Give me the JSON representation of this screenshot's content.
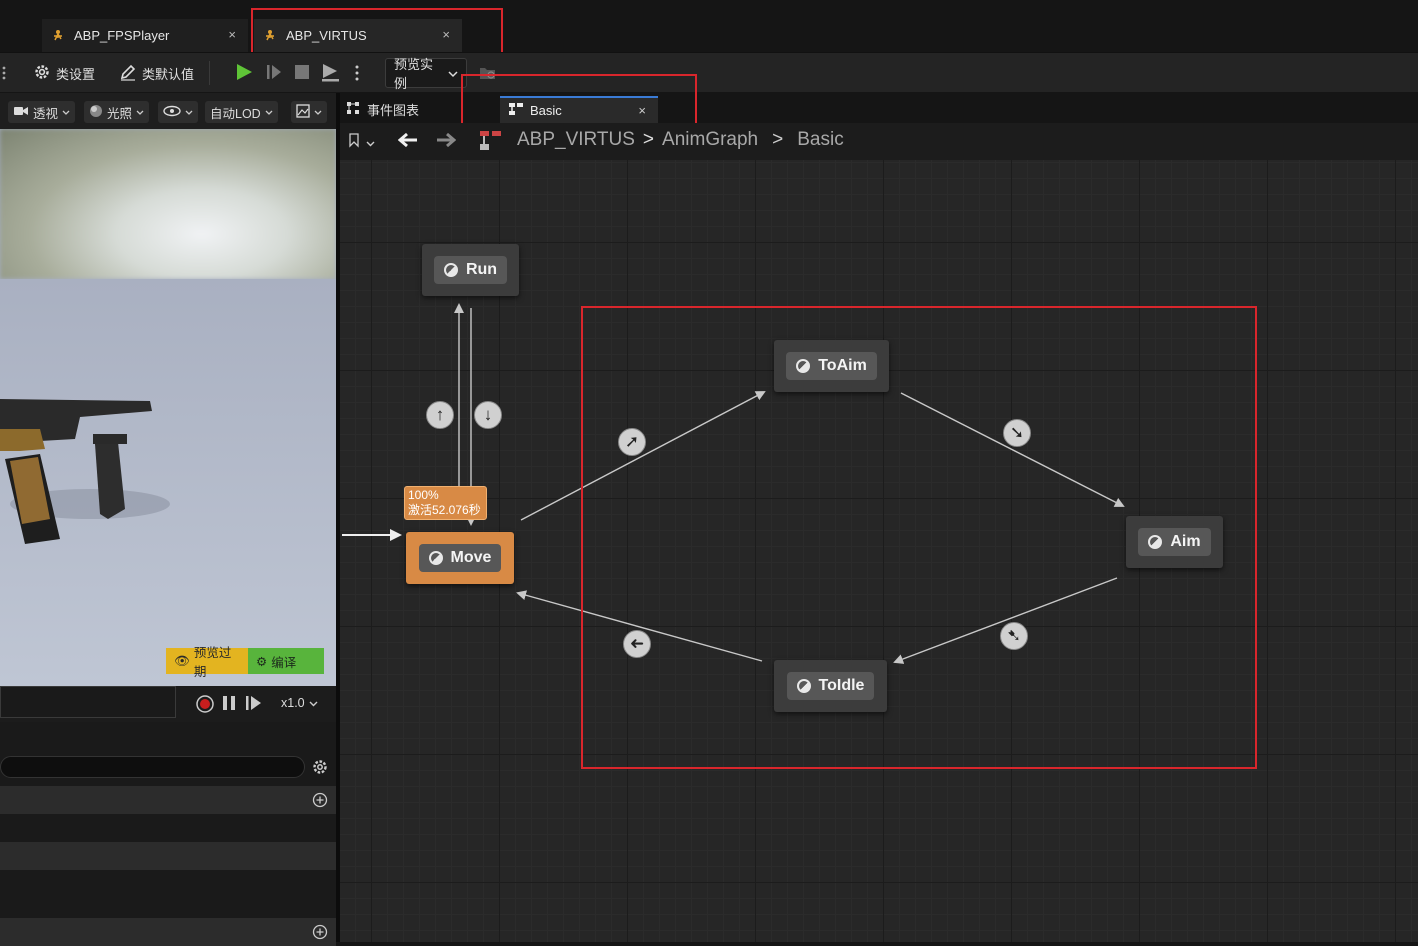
{
  "doc_tabs": [
    {
      "label": "ABP_FPSPlayer",
      "close": "×"
    },
    {
      "label": "ABP_VIRTUS",
      "close": "×"
    }
  ],
  "toolbar": {
    "class_settings": "类设置",
    "class_defaults": "类默认值",
    "preview_instance": "预览实例"
  },
  "viewport_bar": {
    "perspective": "透视",
    "lighting": "光照",
    "auto_lod": "自动LOD"
  },
  "viewport": {
    "preview_outdated": "预览过期",
    "compile": "编译"
  },
  "timeline": {
    "speed": "x1.0"
  },
  "graph_tabs": [
    {
      "label": "事件图表"
    },
    {
      "label": "Basic",
      "close": "×"
    }
  ],
  "breadcrumb": {
    "items": [
      "ABP_VIRTUS",
      "AnimGraph",
      "Basic"
    ],
    "sep": ">"
  },
  "states": {
    "run": "Run",
    "move": "Move",
    "to_aim": "ToAim",
    "aim": "Aim",
    "to_idle": "ToIdle"
  },
  "move_tooltip": {
    "weight": "100%",
    "active": "激活52.076秒"
  },
  "colors": {
    "active_state": "#d88a45",
    "highlight_box": "#d9262c",
    "play_green": "#5fc437",
    "badge_yellow": "#e3b420",
    "badge_green": "#58b43c"
  },
  "icons": {
    "transition_up": "↑",
    "transition_down": "↓",
    "transition_ne": "➚",
    "transition_se": "➘",
    "transition_sw": "➷",
    "transition_w": "➜"
  }
}
